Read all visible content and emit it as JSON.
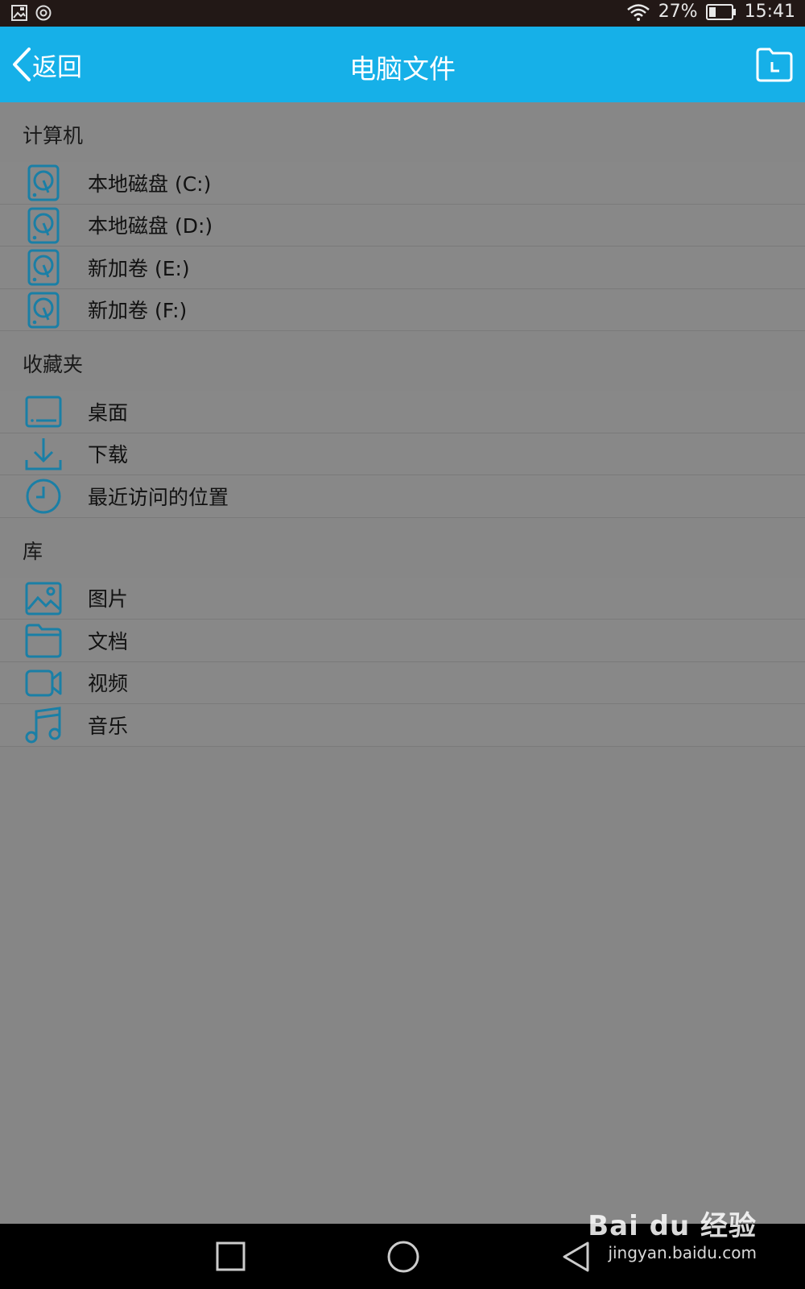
{
  "status_bar": {
    "battery": "27%",
    "time": "15:41"
  },
  "header": {
    "back_label": "返回",
    "title": "电脑文件"
  },
  "sections": [
    {
      "title": "计算机",
      "items": [
        {
          "label": "本地磁盘 (C:)",
          "icon": "hard-drive-icon"
        },
        {
          "label": "本地磁盘 (D:)",
          "icon": "hard-drive-icon"
        },
        {
          "label": "新加卷 (E:)",
          "icon": "hard-drive-icon"
        },
        {
          "label": "新加卷 (F:)",
          "icon": "hard-drive-icon"
        }
      ]
    },
    {
      "title": "收藏夹",
      "items": [
        {
          "label": "桌面",
          "icon": "desktop-icon"
        },
        {
          "label": "下载",
          "icon": "download-icon"
        },
        {
          "label": "最近访问的位置",
          "icon": "clock-icon"
        }
      ]
    },
    {
      "title": "库",
      "items": [
        {
          "label": "图片",
          "icon": "image-icon"
        },
        {
          "label": "文档",
          "icon": "folder-icon"
        },
        {
          "label": "视频",
          "icon": "video-icon"
        },
        {
          "label": "音乐",
          "icon": "music-icon"
        }
      ]
    }
  ],
  "watermark": {
    "brand": "Bai du 经验",
    "url": "jingyan.baidu.com"
  },
  "colors": {
    "accent": "#16b0e8",
    "icon": "#1a7fa6",
    "background": "#878787"
  }
}
